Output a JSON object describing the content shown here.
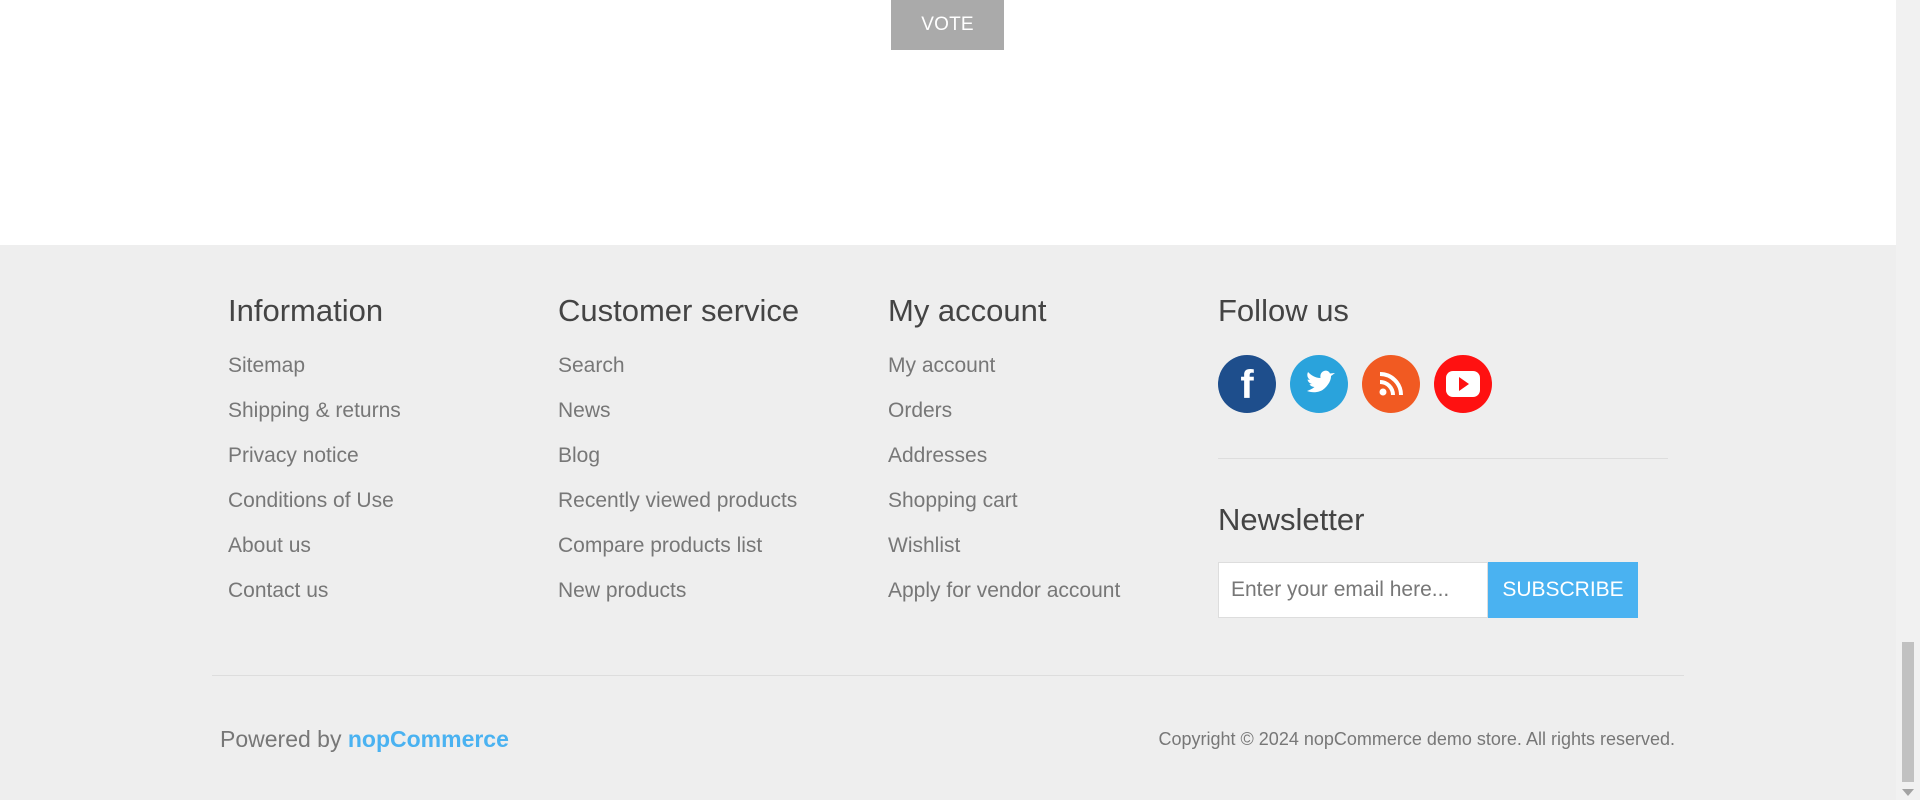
{
  "poll": {
    "vote_label": "VOTE"
  },
  "footer": {
    "information": {
      "title": "Information",
      "items": [
        "Sitemap",
        "Shipping & returns",
        "Privacy notice",
        "Conditions of Use",
        "About us",
        "Contact us"
      ]
    },
    "customer_service": {
      "title": "Customer service",
      "items": [
        "Search",
        "News",
        "Blog",
        "Recently viewed products",
        "Compare products list",
        "New products"
      ]
    },
    "my_account": {
      "title": "My account",
      "items": [
        "My account",
        "Orders",
        "Addresses",
        "Shopping cart",
        "Wishlist",
        "Apply for vendor account"
      ]
    },
    "follow_us": {
      "title": "Follow us",
      "icons": [
        "facebook-icon",
        "twitter-icon",
        "rss-icon",
        "youtube-icon"
      ]
    },
    "newsletter": {
      "title": "Newsletter",
      "email_placeholder": "Enter your email here...",
      "subscribe_label": "SUBSCRIBE"
    },
    "powered_by": {
      "prefix": "Powered by",
      "brand": "nopCommerce"
    },
    "copyright": "Copyright © 2024 nopCommerce demo store. All rights reserved."
  },
  "colors": {
    "footer_bg": "#eeeeee",
    "accent": "#4ab2f1",
    "vote_button": "#aaaaaa",
    "facebook": "#1e4e8c",
    "twitter": "#2aa3dc",
    "rss": "#f15a22",
    "youtube": "#ff1111"
  }
}
